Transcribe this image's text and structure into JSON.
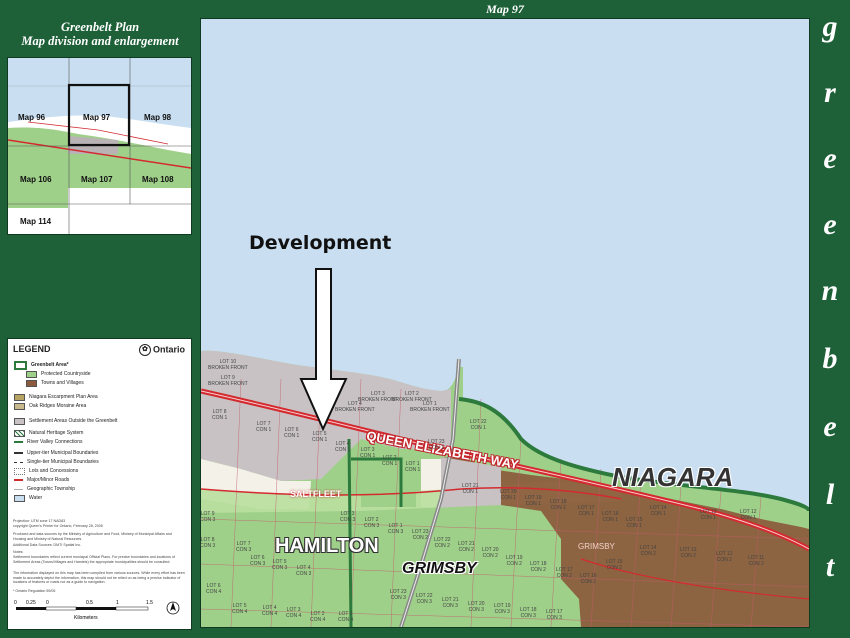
{
  "map_title": "Map 97",
  "side_title_line1": "Greenbelt Plan",
  "side_title_line2": "Map division and enlargement",
  "index_tiles": [
    "Map 96",
    "Map 97",
    "Map 98",
    "Map 106",
    "Map 107",
    "Map 108",
    "Map 114"
  ],
  "legend": {
    "heading": "LEGEND",
    "ontario": "Ontario",
    "items": [
      "Greenbelt Area*",
      "Protected Countryside",
      "Towns and Villages",
      "Niagara Escarpment Plan Area",
      "Oak Ridges Moraine Area",
      "Settlement Areas Outside the Greenbelt",
      "Natural Heritage System",
      "River Valley Connections",
      "Upper-tier Municipal Boundaries",
      "Single-tier Municipal Boundaries",
      "Lots and Concessions",
      "Major/Minor Roads",
      "Geographic Township",
      "Water"
    ],
    "fine_print_1": "Projection: UTM zone 17 NAD83",
    "fine_print_2": "copyright Queen's Printer for Ontario, February 28, 2005",
    "fine_print_3": "Produced and data sources by the Ministry of Agriculture and Food, Ministry of Municipal Affairs and Housing and Ministry of Natural Resources",
    "fine_print_4": "Additional Data Sources: DMTI Spatial Inc.",
    "fine_print_5": "Notes:",
    "fine_print_6": "Settlement boundaries reflect current municipal Official Plans. For precise boundaries and locations of Settlement Areas (Towns/Villages and Hamlets) the appropriate municipalities should be consulted.",
    "fine_print_7": "The information displayed on this map has been compiled from various sources. While every effort has been made to accurately depict the information, this map should not be relied on as being a precise indicator of locations of features or roads nor as a guide to navigation.",
    "fine_print_8": "* Ontario Regulation 59/05",
    "scale_labels": [
      "0",
      "0.25",
      "0",
      "0.5",
      "1",
      "1.5"
    ],
    "scale_unit": "Kilometers"
  },
  "annotation": {
    "label": "Development"
  },
  "places": {
    "niagara": "NIAGARA",
    "hamilton": "HAMILTON",
    "grimsby": "GRIMSBY",
    "qew": "QUEEN ELIZABETH WAY",
    "saltfleet": "SALTFLEET",
    "grimsby_town": "GRIMSBY"
  },
  "lots": [
    "LOT 10\nBROKEN FRONT",
    "LOT 9\nBROKEN FRONT",
    "LOT 3\nBROKEN FRONT",
    "LOT 2\nBROKEN FRONT",
    "LOT 4\nBROKEN FRONT",
    "LOT 1\nBROKEN FRONT",
    "LOT 8\nCON 1",
    "LOT 7\nCON 1",
    "LOT 6\nCON 1",
    "LOT 5\nCON 1",
    "LOT 4\nCON 1",
    "LOT 3\nCON 1",
    "LOT 2\nCON 1",
    "LOT 1\nCON 1",
    "LOT 23\nCON 1",
    "LOT 22\nCON 1",
    "LOT 21\nCON 1",
    "LOT 20\nCON 1",
    "LOT 19\nCON 1",
    "LOT 18\nCON 1",
    "LOT 17\nCON 1",
    "LOT 16\nCON 1",
    "LOT 15\nCON 1",
    "LOT 14\nCON 1",
    "LOT 13\nCON 1",
    "LOT 12\nCON 1",
    "LOT 9\nCON 3",
    "LOT 8\nCON 3",
    "LOT 7\nCON 3",
    "LOT 6\nCON 3",
    "LOT 5\nCON 3",
    "LOT 4\nCON 3",
    "LOT 3\nCON 3",
    "LOT 2\nCON 3",
    "LOT 1\nCON 3",
    "LOT 23\nCON 2",
    "LOT 22\nCON 2",
    "LOT 21\nCON 2",
    "LOT 20\nCON 2",
    "LOT 19\nCON 2",
    "LOT 18\nCON 2",
    "LOT 17\nCON 2",
    "LOT 16\nCON 2",
    "LOT 15\nCON 2",
    "LOT 14\nCON 2",
    "LOT 13\nCON 2",
    "LOT 12\nCON 2",
    "LOT 11\nCON 2",
    "LOT 6\nCON 4",
    "LOT 5\nCON 4",
    "LOT 4\nCON 4",
    "LOT 3\nCON 4",
    "LOT 2\nCON 4",
    "LOT 1\nCON 4",
    "LOT 23\nCON 3",
    "LOT 22\nCON 3",
    "LOT 21\nCON 3",
    "LOT 20\nCON 3",
    "LOT 19\nCON 3",
    "LOT 18\nCON 3",
    "LOT 17\nCON 3"
  ],
  "greenbelt_letters": [
    "g",
    "r",
    "e",
    "e",
    "n",
    "b",
    "e",
    "l",
    "t"
  ],
  "colors": {
    "frame": "#1e6138",
    "water": "#c9dff1",
    "protected_countryside": "#9fd08a",
    "towns_villages": "#8b5a3c",
    "settlement": "#c8c2c4",
    "highway": "#d42a2f"
  }
}
